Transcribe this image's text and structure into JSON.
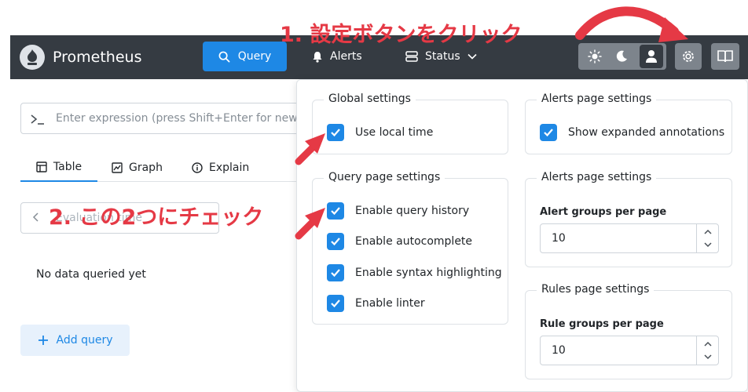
{
  "app": {
    "brand": "Prometheus",
    "nav": {
      "query": "Query",
      "alerts": "Alerts",
      "status": "Status"
    }
  },
  "main": {
    "expression_placeholder": "Enter expression (press Shift+Enter for newlin",
    "tabs": {
      "table": "Table",
      "graph": "Graph",
      "explain": "Explain"
    },
    "evaluation_placeholder": "Evaluation time",
    "no_data": "No data queried yet",
    "add_query": "Add query"
  },
  "settings": {
    "global": {
      "legend": "Global settings",
      "use_local_time": "Use local time"
    },
    "query": {
      "legend": "Query page settings",
      "enable_query_history": "Enable query history",
      "enable_autocomplete": "Enable autocomplete",
      "enable_syntax_highlighting": "Enable syntax highlighting",
      "enable_linter": "Enable linter"
    },
    "alerts_annotations": {
      "legend": "Alerts page settings",
      "show_expanded_annotations": "Show expanded annotations"
    },
    "alerts_groups": {
      "legend": "Alerts page settings",
      "label": "Alert groups per page",
      "value": "10"
    },
    "rules": {
      "legend": "Rules page settings",
      "label": "Rule groups per page",
      "value": "10"
    }
  },
  "annotations": {
    "step1": "1. 設定ボタンをクリック",
    "step2": "2. この2つにチェック"
  },
  "colors": {
    "header_bg": "#353b42",
    "accent": "#1e88e5",
    "annotation": "#e53945"
  }
}
